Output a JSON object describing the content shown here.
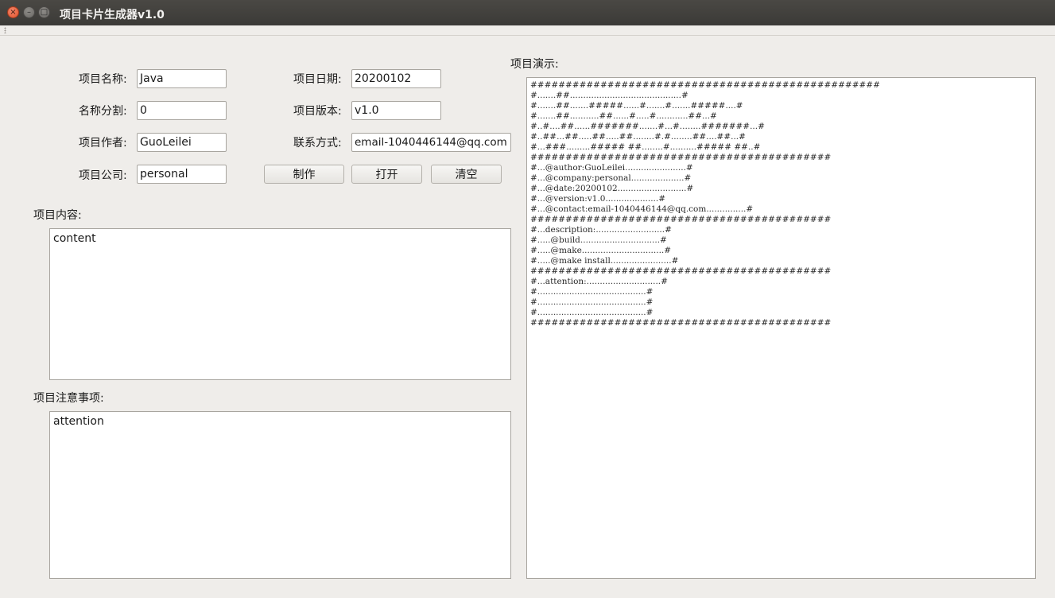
{
  "window": {
    "title": "项目卡片生成器v1.0",
    "close_glyph": "×",
    "min_glyph": "–",
    "max_glyph": "□"
  },
  "form": {
    "name_label": "项目名称:",
    "name_value": "Java",
    "split_label": "名称分割:",
    "split_value": "0",
    "author_label": "项目作者:",
    "author_value": "GuoLeilei",
    "company_label": "项目公司:",
    "company_value": "personal",
    "date_label": "项目日期:",
    "date_value": "20200102",
    "version_label": "项目版本:",
    "version_value": "v1.0",
    "contact_label": "联系方式:",
    "contact_value": "email-1040446144@qq.com"
  },
  "buttons": {
    "make": "制作",
    "open": "打开",
    "clear": "清空"
  },
  "content": {
    "label": "项目内容:",
    "value": "content"
  },
  "attention": {
    "label": "项目注意事项:",
    "value": "attention"
  },
  "preview": {
    "label": "项目演示:",
    "lines": [
      "##################################################",
      "#.......##..........................................#",
      "#.......##.......#####......#.......#.......#####....#",
      "#.......##...........##......#.....#............##...#",
      "#..#....##......#######.......#...#........#######...#",
      "#..##...##.....##.....##........#.#........##....##...#",
      "#...###.........##### ##........#..........##### ##..#",
      "###########################################",
      "#...@author:GuoLeilei.......................#",
      "#...@company:personal....................#",
      "#...@date:20200102..........................#",
      "#...@version:v1.0....................#",
      "#...@contact:email-1040446144@qq.com...............#",
      "###########################################",
      "#...description:..........................#",
      "#.....@build..............................#",
      "#.....@make...............................#",
      "#.....@make install.......................#",
      "###########################################",
      "#...attention:............................#",
      "#.........................................#",
      "#.........................................#",
      "#.........................................#",
      "###########################################"
    ]
  }
}
